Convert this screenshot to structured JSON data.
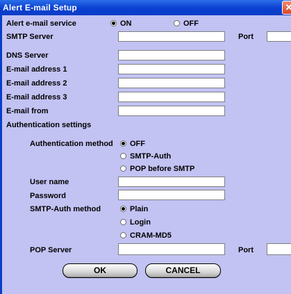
{
  "window": {
    "title": "Alert E-mail Setup",
    "close_glyph": "✕"
  },
  "labels": {
    "alert_service": "Alert e-mail service",
    "smtp_server": "SMTP Server",
    "port": "Port",
    "dns_server": "DNS Server",
    "email1": "E-mail address 1",
    "email2": "E-mail address 2",
    "email3": "E-mail address 3",
    "email_from": "E-mail from",
    "auth_settings": "Authentication settings",
    "auth_method": "Authentication method",
    "user_name": "User name",
    "password": "Password",
    "smtp_auth_method": "SMTP-Auth method",
    "pop_server": "POP Server",
    "pop_port": "Port"
  },
  "service_options": {
    "on": "ON",
    "off": "OFF",
    "selected": "ON"
  },
  "auth_options": {
    "off": "OFF",
    "smtp_auth": "SMTP-Auth",
    "pop_before_smtp": "POP before SMTP",
    "selected": "OFF"
  },
  "smtp_auth_options": {
    "plain": "Plain",
    "login": "Login",
    "cram_md5": "CRAM-MD5",
    "selected": "Plain"
  },
  "fields": {
    "smtp_server": "",
    "smtp_port": "",
    "dns_server": "",
    "email1": "",
    "email2": "",
    "email3": "",
    "email_from": "",
    "user_name": "",
    "password": "",
    "pop_server": "",
    "pop_port": ""
  },
  "buttons": {
    "ok": "OK",
    "cancel": "CANCEL"
  }
}
